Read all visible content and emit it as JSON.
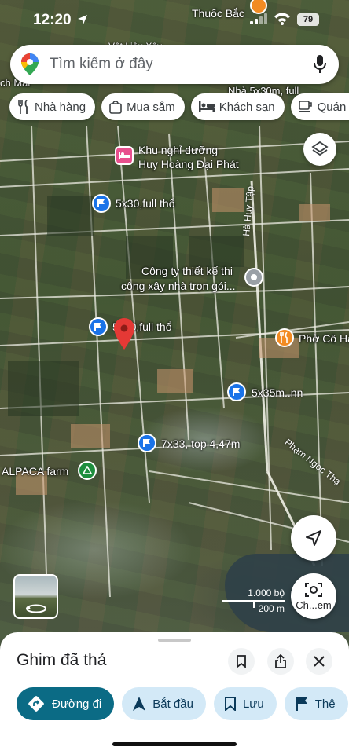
{
  "status_bar": {
    "time": "12:20",
    "battery": "79"
  },
  "search": {
    "placeholder": "Tìm kiếm ở đây"
  },
  "chips": [
    {
      "label": "Nhà hàng",
      "icon": "fork-knife-icon"
    },
    {
      "label": "Mua sắm",
      "icon": "shopping-bag-icon"
    },
    {
      "label": "Khách sạn",
      "icon": "bed-icon"
    },
    {
      "label": "Quán c",
      "icon": "coffee-icon"
    }
  ],
  "map_labels": {
    "top_thuoc_bac": "Thuốc Bắc",
    "top_vat_lieu": "Vật Liệu Xây",
    "top_nha_5x30": "Nhà 5x30m, full",
    "left_ch_mai": "ch Mai",
    "resort_line1": "Khu nghỉ dưỡng",
    "resort_line2": "Huy Hoàng Đại Phát",
    "listing_1": "5x30,full thổ",
    "company_line1": "Công ty thiết kế thi",
    "company_line2": "công xây nhà trọn gói...",
    "listing_2": "5x30,full thổ",
    "pho": "Phở Cô Hà",
    "listing_3": "5x35m..nn",
    "listing_4": "7x33, top 4,47m",
    "alpaca": "ALPACA farm",
    "road_ha_huy_tap": "Hà Huy Tập",
    "road_pham_ngoc_thach": "Phạm Ngọc Thạ"
  },
  "scale": {
    "imperial": "1.000 bộ",
    "metric": "200 m"
  },
  "lens": {
    "label": "Ch...em"
  },
  "sheet": {
    "title": "Ghim đã thả",
    "actions": [
      {
        "label": "Đường đi",
        "icon": "directions-icon"
      },
      {
        "label": "Bắt đầu",
        "icon": "navigation-arrow-icon"
      },
      {
        "label": "Lưu",
        "icon": "bookmark-icon"
      },
      {
        "label": "Thê",
        "icon": "flag-icon"
      }
    ]
  },
  "colors": {
    "accent": "#0b6b85",
    "chip_bg": "#d3e9f7",
    "pin_red": "#e53935",
    "marker_blue": "#1a73e8"
  }
}
